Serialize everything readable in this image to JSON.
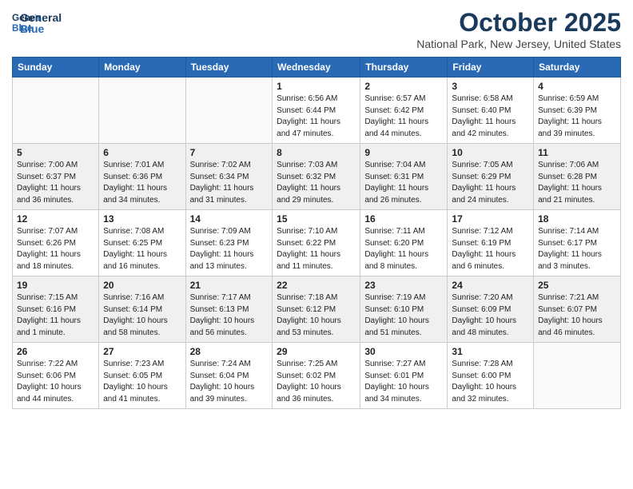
{
  "logo": {
    "line1": "General",
    "line2": "Blue"
  },
  "title": "October 2025",
  "location": "National Park, New Jersey, United States",
  "days_of_week": [
    "Sunday",
    "Monday",
    "Tuesday",
    "Wednesday",
    "Thursday",
    "Friday",
    "Saturday"
  ],
  "weeks": [
    [
      {
        "day": "",
        "info": ""
      },
      {
        "day": "",
        "info": ""
      },
      {
        "day": "",
        "info": ""
      },
      {
        "day": "1",
        "info": "Sunrise: 6:56 AM\nSunset: 6:44 PM\nDaylight: 11 hours\nand 47 minutes."
      },
      {
        "day": "2",
        "info": "Sunrise: 6:57 AM\nSunset: 6:42 PM\nDaylight: 11 hours\nand 44 minutes."
      },
      {
        "day": "3",
        "info": "Sunrise: 6:58 AM\nSunset: 6:40 PM\nDaylight: 11 hours\nand 42 minutes."
      },
      {
        "day": "4",
        "info": "Sunrise: 6:59 AM\nSunset: 6:39 PM\nDaylight: 11 hours\nand 39 minutes."
      }
    ],
    [
      {
        "day": "5",
        "info": "Sunrise: 7:00 AM\nSunset: 6:37 PM\nDaylight: 11 hours\nand 36 minutes."
      },
      {
        "day": "6",
        "info": "Sunrise: 7:01 AM\nSunset: 6:36 PM\nDaylight: 11 hours\nand 34 minutes."
      },
      {
        "day": "7",
        "info": "Sunrise: 7:02 AM\nSunset: 6:34 PM\nDaylight: 11 hours\nand 31 minutes."
      },
      {
        "day": "8",
        "info": "Sunrise: 7:03 AM\nSunset: 6:32 PM\nDaylight: 11 hours\nand 29 minutes."
      },
      {
        "day": "9",
        "info": "Sunrise: 7:04 AM\nSunset: 6:31 PM\nDaylight: 11 hours\nand 26 minutes."
      },
      {
        "day": "10",
        "info": "Sunrise: 7:05 AM\nSunset: 6:29 PM\nDaylight: 11 hours\nand 24 minutes."
      },
      {
        "day": "11",
        "info": "Sunrise: 7:06 AM\nSunset: 6:28 PM\nDaylight: 11 hours\nand 21 minutes."
      }
    ],
    [
      {
        "day": "12",
        "info": "Sunrise: 7:07 AM\nSunset: 6:26 PM\nDaylight: 11 hours\nand 18 minutes."
      },
      {
        "day": "13",
        "info": "Sunrise: 7:08 AM\nSunset: 6:25 PM\nDaylight: 11 hours\nand 16 minutes."
      },
      {
        "day": "14",
        "info": "Sunrise: 7:09 AM\nSunset: 6:23 PM\nDaylight: 11 hours\nand 13 minutes."
      },
      {
        "day": "15",
        "info": "Sunrise: 7:10 AM\nSunset: 6:22 PM\nDaylight: 11 hours\nand 11 minutes."
      },
      {
        "day": "16",
        "info": "Sunrise: 7:11 AM\nSunset: 6:20 PM\nDaylight: 11 hours\nand 8 minutes."
      },
      {
        "day": "17",
        "info": "Sunrise: 7:12 AM\nSunset: 6:19 PM\nDaylight: 11 hours\nand 6 minutes."
      },
      {
        "day": "18",
        "info": "Sunrise: 7:14 AM\nSunset: 6:17 PM\nDaylight: 11 hours\nand 3 minutes."
      }
    ],
    [
      {
        "day": "19",
        "info": "Sunrise: 7:15 AM\nSunset: 6:16 PM\nDaylight: 11 hours\nand 1 minute."
      },
      {
        "day": "20",
        "info": "Sunrise: 7:16 AM\nSunset: 6:14 PM\nDaylight: 10 hours\nand 58 minutes."
      },
      {
        "day": "21",
        "info": "Sunrise: 7:17 AM\nSunset: 6:13 PM\nDaylight: 10 hours\nand 56 minutes."
      },
      {
        "day": "22",
        "info": "Sunrise: 7:18 AM\nSunset: 6:12 PM\nDaylight: 10 hours\nand 53 minutes."
      },
      {
        "day": "23",
        "info": "Sunrise: 7:19 AM\nSunset: 6:10 PM\nDaylight: 10 hours\nand 51 minutes."
      },
      {
        "day": "24",
        "info": "Sunrise: 7:20 AM\nSunset: 6:09 PM\nDaylight: 10 hours\nand 48 minutes."
      },
      {
        "day": "25",
        "info": "Sunrise: 7:21 AM\nSunset: 6:07 PM\nDaylight: 10 hours\nand 46 minutes."
      }
    ],
    [
      {
        "day": "26",
        "info": "Sunrise: 7:22 AM\nSunset: 6:06 PM\nDaylight: 10 hours\nand 44 minutes."
      },
      {
        "day": "27",
        "info": "Sunrise: 7:23 AM\nSunset: 6:05 PM\nDaylight: 10 hours\nand 41 minutes."
      },
      {
        "day": "28",
        "info": "Sunrise: 7:24 AM\nSunset: 6:04 PM\nDaylight: 10 hours\nand 39 minutes."
      },
      {
        "day": "29",
        "info": "Sunrise: 7:25 AM\nSunset: 6:02 PM\nDaylight: 10 hours\nand 36 minutes."
      },
      {
        "day": "30",
        "info": "Sunrise: 7:27 AM\nSunset: 6:01 PM\nDaylight: 10 hours\nand 34 minutes."
      },
      {
        "day": "31",
        "info": "Sunrise: 7:28 AM\nSunset: 6:00 PM\nDaylight: 10 hours\nand 32 minutes."
      },
      {
        "day": "",
        "info": ""
      }
    ]
  ]
}
